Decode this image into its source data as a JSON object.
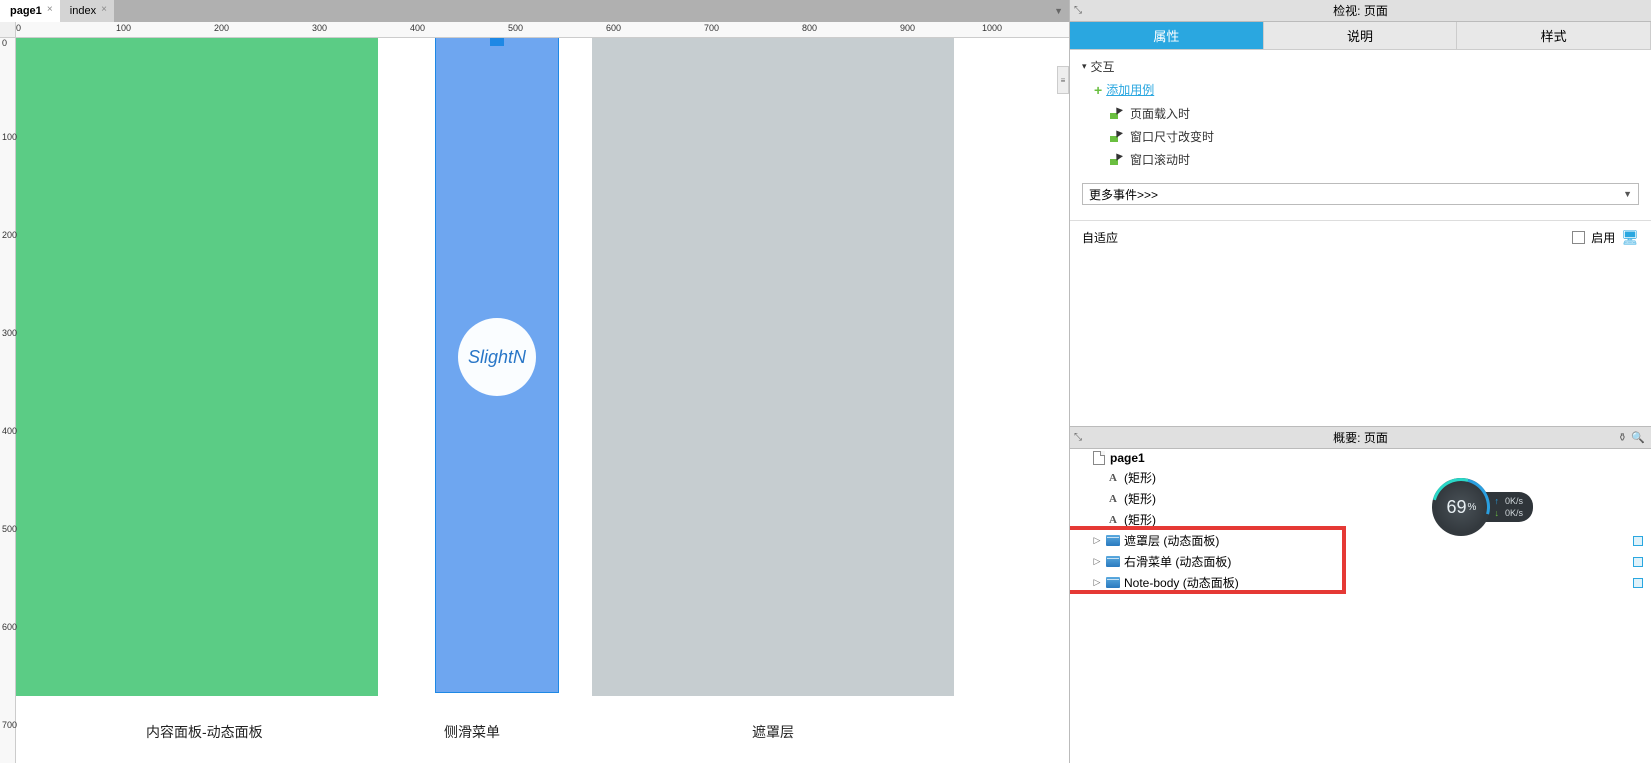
{
  "tabs": {
    "page1": "page1",
    "index": "index"
  },
  "ruler_h": [
    "0",
    "100",
    "200",
    "300",
    "400",
    "500",
    "600",
    "700",
    "800",
    "900",
    "1000"
  ],
  "ruler_v": [
    "0",
    "100",
    "200",
    "300",
    "400",
    "500",
    "600",
    "700"
  ],
  "canvas": {
    "logo_text": "SlightN",
    "label_green": "内容面板-动态面板",
    "label_blue": "侧滑菜单",
    "label_gray": "遮罩层"
  },
  "inspector": {
    "header_top": "检视: 页面",
    "tab_props": "属性",
    "tab_notes": "说明",
    "tab_style": "样式",
    "interaction_heading": "交互",
    "add_case": "添加用例",
    "events": {
      "page_load": "页面载入时",
      "window_resize": "窗口尺寸改变时",
      "window_scroll": "窗口滚动时"
    },
    "more_events": "更多事件>>>",
    "adaptive_label": "自适应",
    "adaptive_enable": "启用"
  },
  "outline": {
    "header": "概要: 页面",
    "page_root": "page1",
    "rect_label": "(矩形)",
    "panel_mask": "遮罩层 (动态面板)",
    "panel_slide": "右滑菜单 (动态面板)",
    "panel_note": "Note-body (动态面板)"
  },
  "widget": {
    "gauge": "69",
    "pct": "%",
    "up": "0K/s",
    "down": "0K/s"
  }
}
